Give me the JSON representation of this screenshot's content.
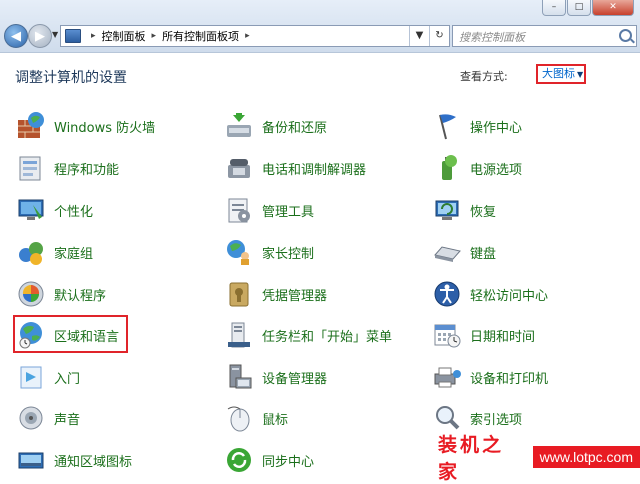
{
  "window_controls": {
    "minimize": "–",
    "maximize": "□",
    "close": "✕"
  },
  "address_bar": {
    "breadcrumb": [
      "控制面板",
      "所有控制面板项"
    ],
    "search_placeholder": "搜索控制面板"
  },
  "heading": "调整计算机的设置",
  "view_by": {
    "label": "查看方式:",
    "value": "大图标"
  },
  "items": [
    {
      "label": "Windows 防火墙",
      "icon": "firewall-icon"
    },
    {
      "label": "备份和还原",
      "icon": "backup-icon"
    },
    {
      "label": "操作中心",
      "icon": "action-center-flag-icon"
    },
    {
      "label": "程序和功能",
      "icon": "programs-icon"
    },
    {
      "label": "电话和调制解调器",
      "icon": "phone-modem-icon"
    },
    {
      "label": "电源选项",
      "icon": "power-options-icon"
    },
    {
      "label": "个性化",
      "icon": "personalize-icon"
    },
    {
      "label": "管理工具",
      "icon": "admin-tools-icon"
    },
    {
      "label": "恢复",
      "icon": "recovery-icon"
    },
    {
      "label": "家庭组",
      "icon": "homegroup-icon"
    },
    {
      "label": "家长控制",
      "icon": "parental-controls-icon"
    },
    {
      "label": "键盘",
      "icon": "keyboard-icon"
    },
    {
      "label": "默认程序",
      "icon": "default-programs-icon"
    },
    {
      "label": "凭据管理器",
      "icon": "credential-manager-icon"
    },
    {
      "label": "轻松访问中心",
      "icon": "ease-of-access-icon"
    },
    {
      "label": "区域和语言",
      "icon": "region-language-globe-icon"
    },
    {
      "label": "任务栏和「开始」菜单",
      "icon": "taskbar-start-icon"
    },
    {
      "label": "日期和时间",
      "icon": "date-time-icon"
    },
    {
      "label": "入门",
      "icon": "getting-started-icon"
    },
    {
      "label": "设备管理器",
      "icon": "device-manager-icon"
    },
    {
      "label": "设备和打印机",
      "icon": "devices-printers-icon"
    },
    {
      "label": "声音",
      "icon": "sound-icon"
    },
    {
      "label": "鼠标",
      "icon": "mouse-icon"
    },
    {
      "label": "索引选项",
      "icon": "indexing-options-icon"
    },
    {
      "label": "通知区域图标",
      "icon": "notification-area-icon"
    },
    {
      "label": "同步中心",
      "icon": "sync-center-icon"
    }
  ],
  "watermark": {
    "logo": "装机之家",
    "url": "www.lotpc.com"
  }
}
